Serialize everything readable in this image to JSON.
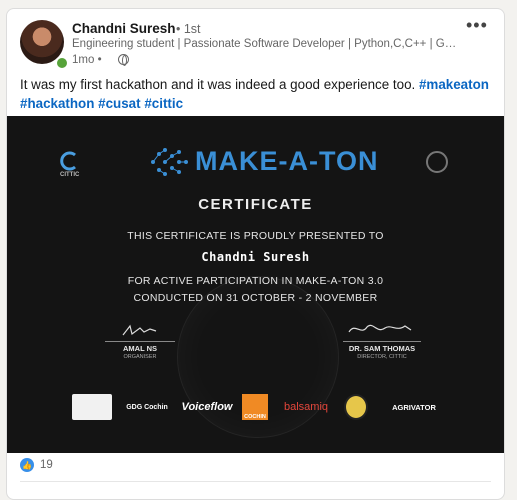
{
  "post": {
    "author_name": "Chandni Suresh",
    "connection_degree": "• 1st",
    "headline": "Engineering student | Passionate Software Developer | Python,C,C++ | Graduati...",
    "time": "1mo •",
    "text_intro": "It was my first hackathon and it was indeed a good experience too. ",
    "hashtags": [
      "#makeaton",
      "#hackathon",
      "#cusat",
      "#cittic"
    ],
    "more_menu": "•••"
  },
  "certificate": {
    "brand": "MAKE-A-TON",
    "left_logo_label": "CITTIC",
    "title": "CERTIFICATE",
    "line1": "THIS CERTIFICATE IS PROUDLY PRESENTED TO",
    "recipient": "Chandni Suresh",
    "line2": "FOR ACTIVE PARTICIPATION IN MAKE-A-TON 3.0",
    "line3": "CONDUCTED ON 31 OCTOBER - 2 NOVEMBER",
    "signatories": [
      {
        "name": "AMAL NS",
        "role": "ORGANISER"
      },
      {
        "name": "DR. SAM THOMAS",
        "role": "DIRECTOR, CITTIC"
      }
    ],
    "sponsors": [
      "GDG Cochin",
      "Voiceflow",
      "COCHIN",
      "balsamiq",
      "AGRIVATOR"
    ]
  },
  "social": {
    "reaction_count": "19"
  },
  "colors": {
    "hashtag": "#0a66c2",
    "brand_blue": "#3a8fd6",
    "like_blue": "#378fe9",
    "cert_bg": "#141414"
  }
}
